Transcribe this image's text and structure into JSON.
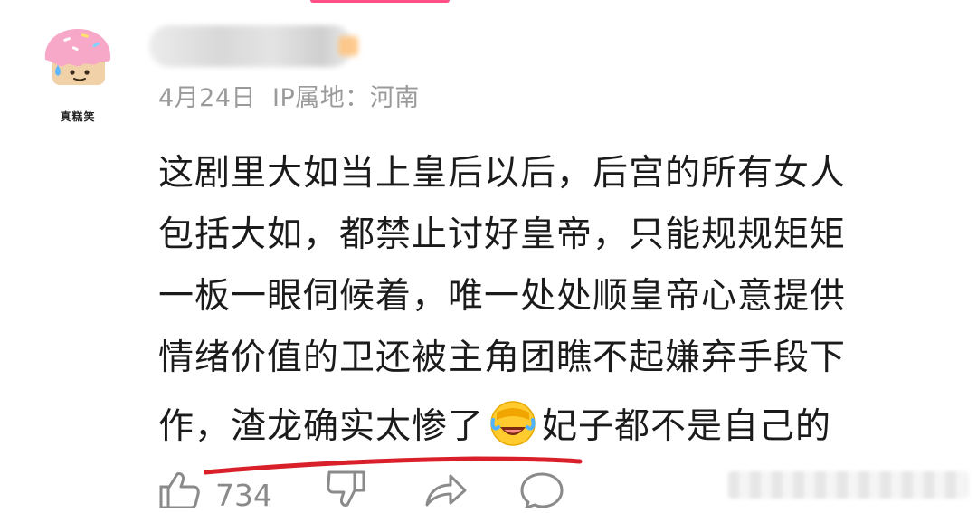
{
  "comment": {
    "avatar_caption": "真糕笑",
    "date": "4月24日",
    "ip_location": "IP属地：河南",
    "lines": [
      "这剧里大如当上皇后以后，后宫的所有女人",
      "包括大如，都禁止讨好皇帝，只能规规矩矩",
      "一板一眼伺候着，唯一处处顺皇帝心意提供",
      "情绪价值的卫还被主角团瞧不起嫌弃手段下"
    ],
    "last_line_before_emoji": "作，渣龙确实太惨了",
    "emoji": "laughing-crying-face",
    "last_line_after_emoji": "妃子都不是自己的",
    "likes": "734"
  },
  "colors": {
    "accent_tab": "#ff4f86",
    "underline": "#d9202a",
    "meta_text": "#9a9a9a",
    "action_icon": "#8a8a8a"
  },
  "icons": [
    "thumbs-up-icon",
    "thumbs-down-icon",
    "share-icon",
    "comment-icon"
  ]
}
